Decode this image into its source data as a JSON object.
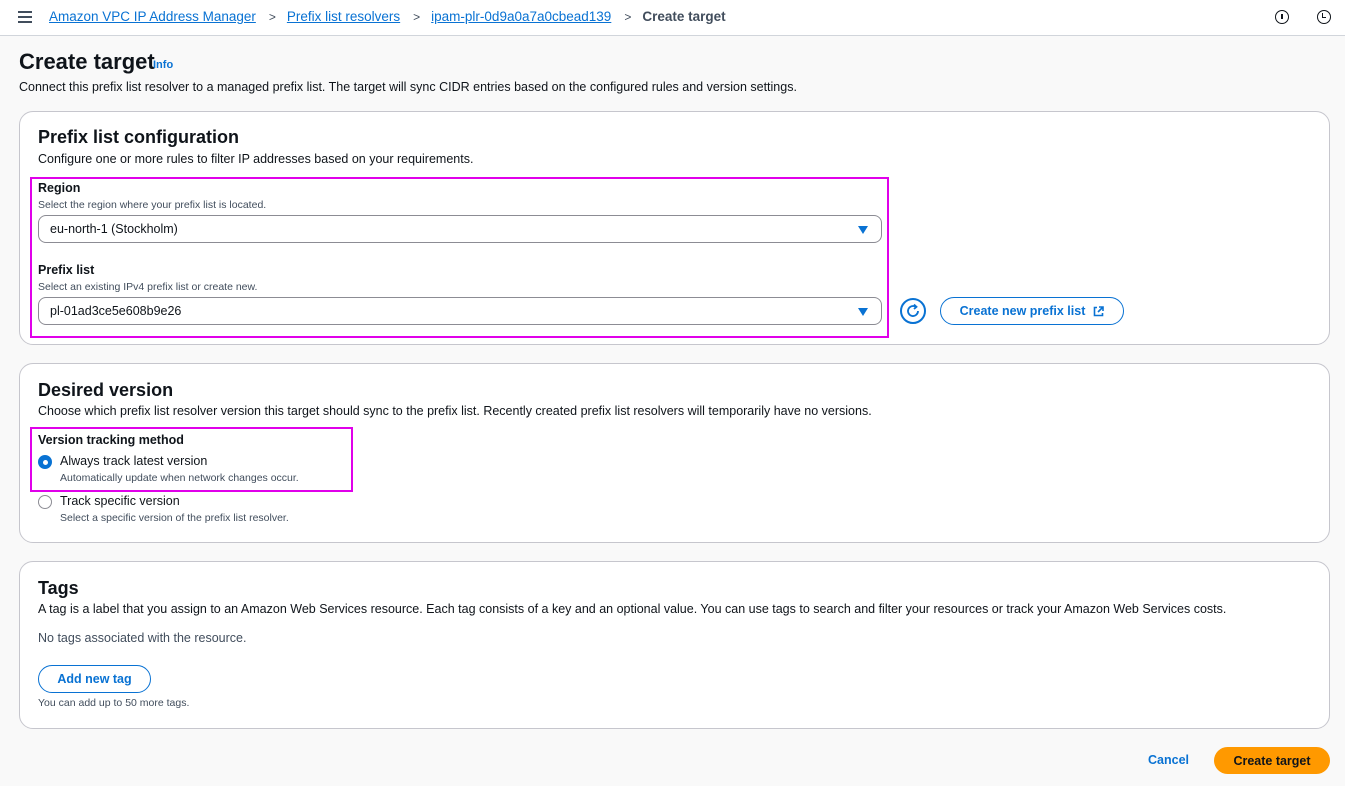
{
  "breadcrumb": {
    "items": [
      "Amazon VPC IP Address Manager",
      "Prefix list resolvers",
      "ipam-plr-0d9a0a7a0cbead139"
    ],
    "separator": ">",
    "current": "Create target"
  },
  "header": {
    "title": "Create target",
    "info_label": "Info",
    "description": "Connect this prefix list resolver to a managed prefix list. The target will sync CIDR entries based on the configured rules and version settings."
  },
  "prefix_config": {
    "title": "Prefix list configuration",
    "description": "Configure one or more rules to filter IP addresses based on your requirements.",
    "region": {
      "label": "Region",
      "hint": "Select the region where your prefix list is located.",
      "value": "eu-north-1 (Stockholm)"
    },
    "prefix_list": {
      "label": "Prefix list",
      "hint": "Select an existing IPv4 prefix list or create new.",
      "value": "pl-01ad3ce5e608b9e26"
    },
    "create_button_label": "Create new prefix list"
  },
  "desired_version": {
    "title": "Desired version",
    "description": "Choose which prefix list resolver version this target should sync to the prefix list. Recently created prefix list resolvers will temporarily have no versions.",
    "method_label": "Version tracking method",
    "options": [
      {
        "label": "Always track latest version",
        "description": "Automatically update when network changes occur.",
        "selected": true
      },
      {
        "label": "Track specific version",
        "description": "Select a specific version of the prefix list resolver.",
        "selected": false
      }
    ]
  },
  "tags": {
    "title": "Tags",
    "description": "A tag is a label that you assign to an Amazon Web Services resource. Each tag consists of a key and an optional value. You can use tags to search and filter your resources or track your Amazon Web Services costs.",
    "empty_text": "No tags associated with the resource.",
    "add_button_label": "Add new tag",
    "limit_text": "You can add up to 50 more tags."
  },
  "footer": {
    "cancel_label": "Cancel",
    "submit_label": "Create target"
  },
  "colors": {
    "accent": "#0972d3",
    "primary_button": "#ff9900",
    "highlight": "#e000ea"
  }
}
